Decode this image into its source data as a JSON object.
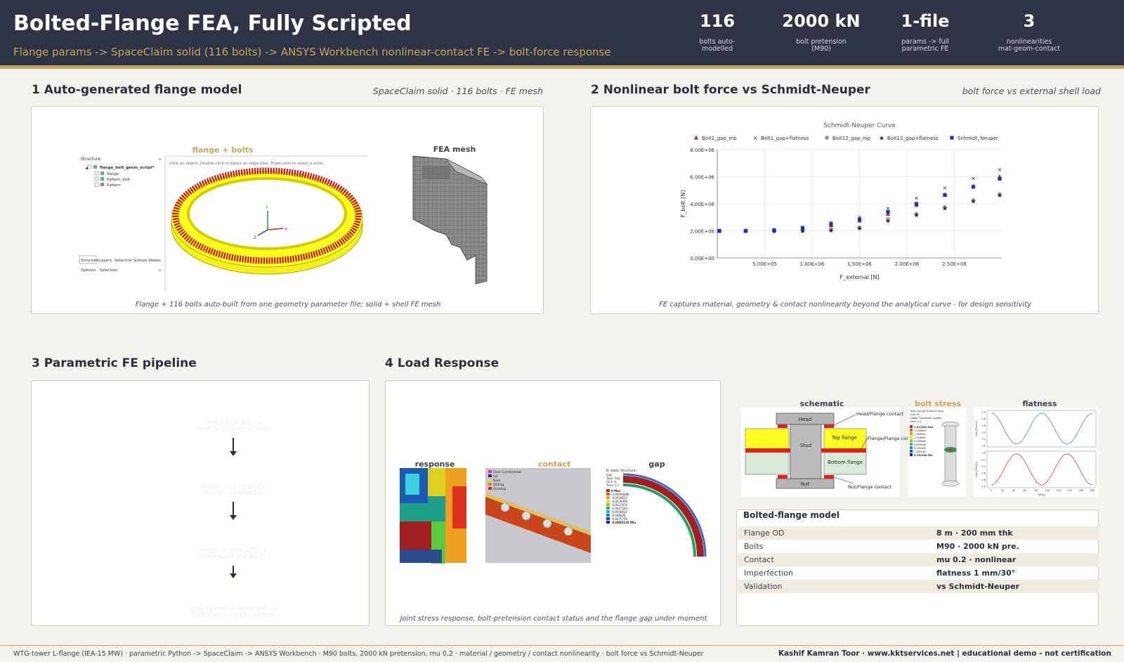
{
  "header": {
    "title": "Bolted-Flange FEA, Fully Scripted",
    "subtitle": "Flange params -> SpaceClaim solid (116 bolts) -> ANSYS Workbench nonlinear-contact FE -> bolt-force response",
    "kpis": [
      {
        "value": "116",
        "label": "bolts auto-\nmodelled"
      },
      {
        "value": "2000 kN",
        "label": "bolt pretension\n(M90)"
      },
      {
        "value": "1-file",
        "label": "params -> full\nparametric FE"
      },
      {
        "value": "3",
        "label": "nonlinearities\nmat-geom-contact"
      }
    ]
  },
  "sec1": {
    "title": "1  Auto-generated flange model",
    "note": "SpaceClaim solid  ·  116 bolts  ·  FE mesh",
    "label_flange": "flange + bolts",
    "label_mesh": "FEA mesh",
    "tree": {
      "structure": "Structure",
      "root": "flange_bolt_geom_script*",
      "items": [
        "flange",
        "Pattern_bolt",
        "Pattern"
      ],
      "hint": "Click an object. Double-click to select an edge loop. Triple-click to select a solid.",
      "tabs": [
        "Structure",
        "Layers",
        "Selection Groups",
        "Views"
      ],
      "options": "Options - Selection",
      "axes": [
        "Y",
        "X",
        "Z"
      ]
    },
    "caption": "Flange + 116 bolts auto-built from one geometry parameter file; solid + shell FE mesh"
  },
  "sec2": {
    "title": "2  Nonlinear bolt force vs Schmidt-Neuper",
    "note": "bolt force vs external shell load",
    "caption": "FE captures material, geometry & contact nonlinearity beyond the analytical curve - for design sensitivity"
  },
  "chart_data": {
    "type": "scatter",
    "title": "Schmidt-Neuper Curve",
    "xlabel": "F_external [N]",
    "ylabel": "F_bolt [N]",
    "x_ticks": [
      "5.00E+05",
      "1.00E+06",
      "1.50E+06",
      "2.00E+06",
      "2.50E+06"
    ],
    "y_ticks": [
      "0.00E+00",
      "2.00E+06",
      "4.00E+06",
      "6.00E+06",
      "8.00E+06"
    ],
    "xlim": [
      0,
      3000000
    ],
    "ylim": [
      0,
      8000000
    ],
    "grid": true,
    "legend_position": "top",
    "x": [
      0,
      300000,
      600000,
      900000,
      1200000,
      1500000,
      1800000,
      2100000,
      2400000,
      2700000,
      3000000
    ],
    "series": [
      {
        "name": "Bolt1_gap_mp",
        "marker": "triangle",
        "color": "#d62020",
        "values": [
          2000000,
          2000000,
          2050000,
          2150000,
          2400000,
          2750000,
          3250000,
          3900000,
          4650000,
          5300000,
          6000000
        ]
      },
      {
        "name": "Bolt1_gap+flatness",
        "marker": "x",
        "color": "#222222",
        "values": [
          2000000,
          2000000,
          2100000,
          2300000,
          2650000,
          3050000,
          3700000,
          4450000,
          5200000,
          5900000,
          6550000
        ]
      },
      {
        "name": "Bolt12_gap_mp",
        "marker": "circle",
        "color": "#9a9a9a",
        "values": [
          2000000,
          2000000,
          2000000,
          2050000,
          2100000,
          2250000,
          2850000,
          3250000,
          3750000,
          4250000,
          4700000
        ]
      },
      {
        "name": "Bolt12_gap+flatness",
        "marker": "star",
        "color": "#222222",
        "values": [
          2000000,
          2000000,
          2000000,
          2000000,
          2050000,
          2200000,
          2750000,
          3200000,
          3700000,
          4200000,
          4650000
        ]
      },
      {
        "name": "Schmidt_Neuper",
        "marker": "square",
        "color": "#1a2fd0",
        "values": [
          2000000,
          2000000,
          2050000,
          2200000,
          2500000,
          2850000,
          3400000,
          4000000,
          4650000,
          5250000,
          5850000
        ]
      }
    ]
  },
  "sec3": {
    "title": "3  Parametric FE pipeline",
    "steps": [
      {
        "head": "flange geometry params",
        "sub": "one input file ->\nbolt & no-bolt scripts",
        "color": "#c9a45c"
      },
      {
        "head": "SpaceClaim solid model",
        "sub": "flange + 116 bolts,\nfull or symmetric",
        "color": "#525a72"
      },
      {
        "head": "Workbench FE assembly",
        "sub": "mesh + contacts +\npretension (all bolts)",
        "color": "#525a72"
      },
      {
        "head": "nonlinear solve + results",
        "sub": "pretension + moment ->\nbolt force / gap / stress",
        "color": "#3aa04a"
      }
    ]
  },
  "sec4": {
    "title": "4  Load Response",
    "labels": {
      "response": "response",
      "contact": "contact",
      "gap": "gap"
    },
    "contact_legend": [
      "Over Constrained",
      "Far",
      "Near",
      "Sliding",
      "Sticking"
    ],
    "gap_legend_title": "B: Static Structural",
    "gap_legend_lines": [
      "Gap",
      "Type: Gap",
      "Unit: m",
      "Time: 2 s"
    ],
    "gap_max": "0 Max",
    "gap_vals": [
      "-0.00094686",
      "-0.0018937",
      "-0.0028406",
      "-0.0037874",
      "-0.0047343",
      "-0.0056812",
      "-0.006628",
      "-0.0075749"
    ],
    "gap_min": "-0.0085218 Min",
    "caption": "Joint stress response, bolt-pretension contact status and the flange gap under moment"
  },
  "side_figs": {
    "schematic": "schematic",
    "bolt_stress": "bolt stress",
    "flatness": "flatness",
    "schem_labels": {
      "head": "Head",
      "stud": "Stud",
      "nut": "Nut",
      "top": "Top flange",
      "bottom": "Bottom flange",
      "hf": "Head/Flange\ncontact",
      "ff": "Flange/Flange\ncontact",
      "nf": "Nut/Flange\ncontact"
    },
    "stress_legend_title": "Type: Normal Stress(Z Axis)",
    "stress_legend_lines": [
      "Unit: Pa",
      "Global Coordinate System",
      "Time: 2 s"
    ],
    "stress_max": "1.2176e9 Max",
    "stress_vals": [
      "1.1506e9",
      "1.0836e9",
      "1.0166e9",
      "9.4956e8",
      "8.8255e8",
      "8.1554e8",
      "7.4852e8"
    ],
    "stress_min": "6.7815e8 Min",
    "flat_x_ticks": [
      "0",
      "20",
      "40",
      "60",
      "80",
      "100",
      "120",
      "140",
      "160",
      "180"
    ],
    "flat_top_y": [
      "1.0",
      "0.8",
      "0.6",
      "0.4",
      "0.2",
      "0.0"
    ],
    "flat_bot_y": [
      "0.0",
      "-0.2",
      "-0.4",
      "-0.6",
      "-0.8",
      "-1.0"
    ],
    "flat_y_label_top": "Gap [Mm/m]",
    "flat_y_label_bot": "Gap [Mm/m]",
    "flat_x_label": "[deg.]"
  },
  "table": {
    "title": "Bolted-flange model",
    "rows": [
      {
        "k": "Flange OD",
        "v": "8 m · 200 mm thk"
      },
      {
        "k": "Bolts",
        "v": "M90 · 2000 kN pre."
      },
      {
        "k": "Contact",
        "v": "mu 0.2 · nonlinear"
      },
      {
        "k": "Imperfection",
        "v": "flatness 1 mm/30°"
      },
      {
        "k": "Validation",
        "v": "vs Schmidt-Neuper"
      }
    ]
  },
  "footer": {
    "left": "WTG-tower L-flange (IEA-15 MW)  ·  parametric Python -> SpaceClaim -> ANSYS Workbench  ·  M90 bolts, 2000 kN pretension, mu 0.2  ·  material / geometry / contact nonlinearity  ·  bolt force vs Schmidt-Neuper",
    "right": "Kashif Kamran Toor  ·  www.kktservices.net   |   educational demo - not certification"
  },
  "colors": {
    "navy": "#2e3446",
    "gold": "#c9a45c",
    "slate": "#525a72",
    "green": "#3aa04a"
  }
}
